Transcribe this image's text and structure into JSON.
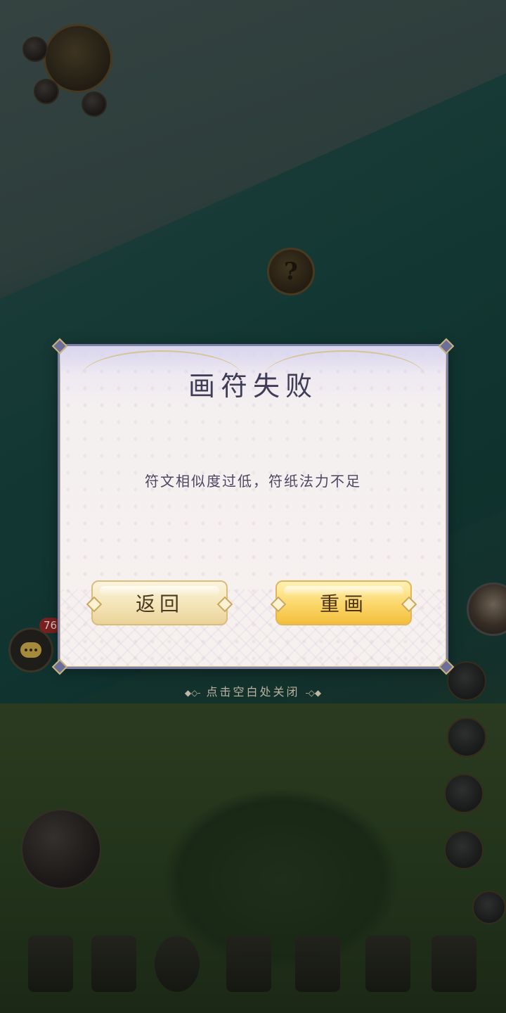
{
  "dialog": {
    "title": "画符失败",
    "message": "符文相似度过低，符纸法力不足",
    "buttons": {
      "back_label": "返回",
      "redraw_label": "重画"
    }
  },
  "close_hint": "点击空白处关闭",
  "close_hint_left_ornament": "◆◇-",
  "close_hint_right_ornament": "-◇◆",
  "chat": {
    "unread_count": "76"
  },
  "background": {
    "quest_marker": "?"
  },
  "colors": {
    "dialog_border": "#7d7fa6",
    "title_text": "#3f3c55",
    "back_button": "#f4e5b8",
    "redraw_button": "#fbd668"
  }
}
